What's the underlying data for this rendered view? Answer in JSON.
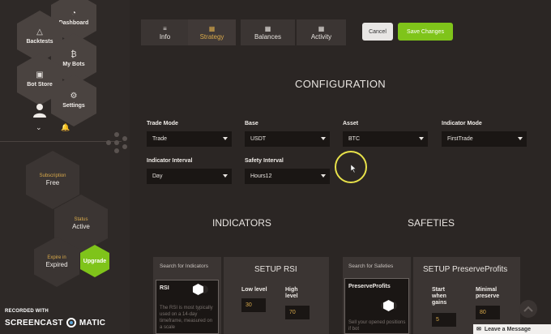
{
  "sidebar": {
    "dashboard": "Dashboard",
    "backtests": "Backtests",
    "mybots": "My Bots",
    "botstore": "Bot Store",
    "settings": "Settings",
    "subscription": {
      "label": "Subscription",
      "value": "Free"
    },
    "status": {
      "label": "Status",
      "value": "Active"
    },
    "expire": {
      "label": "Expire in",
      "value": "Expired"
    },
    "upgrade": "Upgrade"
  },
  "tabs": [
    {
      "label": "Info",
      "icon": "list-icon"
    },
    {
      "label": "Strategy",
      "icon": "calendar-icon"
    },
    {
      "label": "Balances",
      "icon": "calendar-icon"
    },
    {
      "label": "Activity",
      "icon": "calendar-icon"
    }
  ],
  "toolbar": {
    "cancel": "Cancel",
    "save": "Save Changes"
  },
  "configuration": {
    "title": "CONFIGURATION",
    "fields": {
      "trade_mode": {
        "label": "Trade Mode",
        "value": "Trade"
      },
      "base": {
        "label": "Base",
        "value": "USDT"
      },
      "asset": {
        "label": "Asset",
        "value": "BTC"
      },
      "indicator_mode": {
        "label": "Indicator Mode",
        "value": "FirstTrade"
      },
      "indicator_interval": {
        "label": "Indicator Interval",
        "value": "Day"
      },
      "safety_interval": {
        "label": "Safety Interval",
        "value": "Hours12"
      }
    }
  },
  "indicators": {
    "title": "INDICATORS",
    "search": "Search for Indicators",
    "item": {
      "name": "RSI",
      "desc": "The RSI is most typically used on a 14-day timeframe, measured on a scale"
    },
    "setup": {
      "title": "SETUP RSI",
      "low_label": "Low level",
      "low_value": "30",
      "high_label": "High level",
      "high_value": "70"
    }
  },
  "safeties": {
    "title": "SAFETIES",
    "search": "Search for Safeties",
    "item": {
      "name": "PreserveProfits",
      "desc": "Sell your opened positions if bot"
    },
    "setup": {
      "title": "SETUP PreserveProfits",
      "start_label": "Start when gains",
      "start_value": "5",
      "min_label": "Minimal preserve",
      "min_value": "80"
    }
  },
  "watermark": {
    "line1": "RECORDED WITH",
    "brand_left": "SCREENCAST",
    "brand_right": "MATIC"
  },
  "chat": {
    "label": "Leave a Message"
  },
  "colors": {
    "accent_green": "#7fc41a",
    "accent_gold": "#d8a94a",
    "background": "#2b2624",
    "cursor_ring": "#e8e24a"
  }
}
